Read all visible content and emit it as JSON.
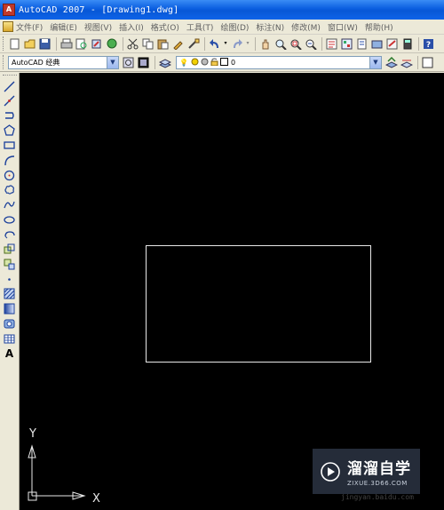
{
  "window": {
    "title": "AutoCAD 2007 - [Drawing1.dwg]",
    "app_icon_text": "A"
  },
  "menubar": {
    "items": [
      {
        "label": "文件(F)"
      },
      {
        "label": "编辑(E)"
      },
      {
        "label": "视图(V)"
      },
      {
        "label": "插入(I)"
      },
      {
        "label": "格式(O)"
      },
      {
        "label": "工具(T)"
      },
      {
        "label": "绘图(D)"
      },
      {
        "label": "标注(N)"
      },
      {
        "label": "修改(M)"
      },
      {
        "label": "窗口(W)"
      },
      {
        "label": "帮助(H)"
      }
    ]
  },
  "toolbar_standard": {
    "icons": [
      "new-icon",
      "open-icon",
      "save-icon",
      "print-icon",
      "plot-preview-icon",
      "publish-icon",
      "3d-dwf-icon",
      "cut-icon",
      "copy-icon",
      "paste-icon",
      "match-properties-icon",
      "block-editor-icon",
      "undo-icon",
      "redo-icon",
      "pan-icon",
      "zoom-realtime-icon",
      "zoom-window-icon",
      "zoom-previous-icon",
      "properties-icon",
      "design-center-icon",
      "tool-palettes-icon",
      "sheet-set-icon",
      "markup-icon",
      "calculator-icon",
      "help-icon"
    ]
  },
  "toolbar_workspace": {
    "workspace_value": "AutoCAD 经典",
    "layer_value": "0"
  },
  "canvas": {
    "background": "#000000",
    "line_color": "#e8e8e8",
    "ucs_x_label": "X",
    "ucs_y_label": "Y"
  },
  "draw_tools": [
    {
      "name": "line-icon"
    },
    {
      "name": "construction-line-icon"
    },
    {
      "name": "polyline-icon"
    },
    {
      "name": "polygon-icon"
    },
    {
      "name": "rectangle-icon"
    },
    {
      "name": "arc-icon"
    },
    {
      "name": "circle-icon"
    },
    {
      "name": "revision-cloud-icon"
    },
    {
      "name": "spline-icon"
    },
    {
      "name": "ellipse-icon"
    },
    {
      "name": "ellipse-arc-icon"
    },
    {
      "name": "insert-block-icon"
    },
    {
      "name": "make-block-icon"
    },
    {
      "name": "point-icon"
    },
    {
      "name": "hatch-icon"
    },
    {
      "name": "gradient-icon"
    },
    {
      "name": "region-icon"
    },
    {
      "name": "table-icon"
    },
    {
      "name": "multiline-text-icon"
    }
  ],
  "watermark": {
    "name": "溜溜自学",
    "url": "ZIXUE.3D66.COM",
    "sub": "jingyan.baidu.com"
  }
}
